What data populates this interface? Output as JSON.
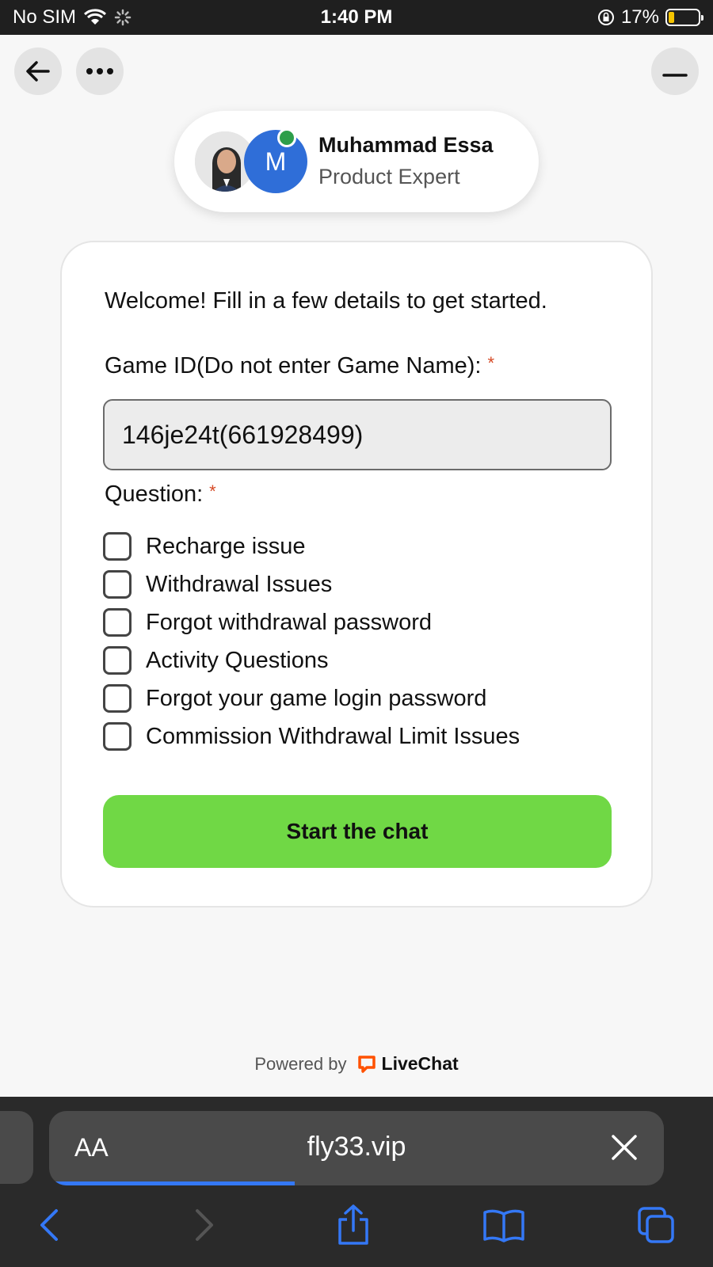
{
  "status_bar": {
    "carrier": "No SIM",
    "time": "1:40 PM",
    "battery": "17%",
    "battery_level": 0.17
  },
  "agent": {
    "initial": "M",
    "name": "Muhammad Essa",
    "role": "Product Expert"
  },
  "form": {
    "welcome": "Welcome! Fill in a few details to get started.",
    "game_id_label": "Game ID(Do not enter Game Name):",
    "game_id_value": "146je24t(661928499)",
    "required_mark": "*",
    "question_label": "Question:",
    "options": [
      "Recharge issue",
      "Withdrawal Issues",
      "Forgot withdrawal password",
      "Activity Questions",
      "Forgot your game login password",
      "Commission Withdrawal Limit Issues"
    ],
    "submit": "Start the chat"
  },
  "footer": {
    "powered_by": "Powered by",
    "brand": "LiveChat"
  },
  "browser": {
    "aa": "AA",
    "url": "fly33.vip",
    "load_progress": 0.4
  },
  "colors": {
    "accent_green": "#70d845",
    "required": "#d64a26",
    "link_blue": "#3478f6",
    "livechat_orange": "#ff5100"
  }
}
